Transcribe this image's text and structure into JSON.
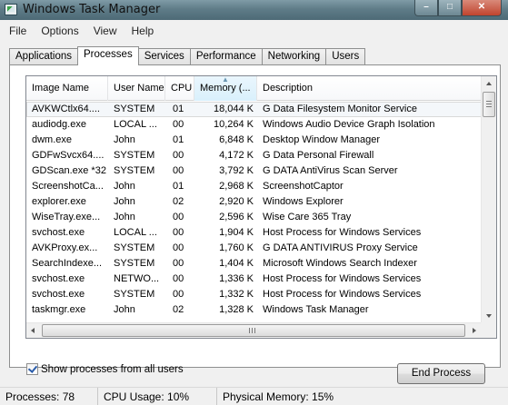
{
  "window": {
    "title": "Windows Task Manager"
  },
  "menu": [
    "File",
    "Options",
    "View",
    "Help"
  ],
  "tabs": [
    "Applications",
    "Processes",
    "Services",
    "Performance",
    "Networking",
    "Users"
  ],
  "active_tab": "Processes",
  "columns": [
    "Image Name",
    "User Name",
    "CPU",
    "Memory (...",
    "Description"
  ],
  "sorted_column": "Memory (...",
  "processes": [
    {
      "name": "AVKWCtlx64....",
      "user": "SYSTEM",
      "cpu": "01",
      "memory": "18,044 K",
      "description": "G Data Filesystem Monitor Service"
    },
    {
      "name": "audiodg.exe",
      "user": "LOCAL ...",
      "cpu": "00",
      "memory": "10,264 K",
      "description": "Windows Audio Device Graph Isolation"
    },
    {
      "name": "dwm.exe",
      "user": "John",
      "cpu": "01",
      "memory": "6,848 K",
      "description": "Desktop Window Manager"
    },
    {
      "name": "GDFwSvcx64....",
      "user": "SYSTEM",
      "cpu": "00",
      "memory": "4,172 K",
      "description": "G Data Personal Firewall"
    },
    {
      "name": "GDScan.exe *32",
      "user": "SYSTEM",
      "cpu": "00",
      "memory": "3,792 K",
      "description": "G DATA AntiVirus Scan Server"
    },
    {
      "name": "ScreenshotCa...",
      "user": "John",
      "cpu": "01",
      "memory": "2,968 K",
      "description": "ScreenshotCaptor"
    },
    {
      "name": "explorer.exe",
      "user": "John",
      "cpu": "02",
      "memory": "2,920 K",
      "description": "Windows Explorer"
    },
    {
      "name": "WiseTray.exe...",
      "user": "John",
      "cpu": "00",
      "memory": "2,596 K",
      "description": "Wise Care 365 Tray"
    },
    {
      "name": "svchost.exe",
      "user": "LOCAL ...",
      "cpu": "00",
      "memory": "1,904 K",
      "description": "Host Process for Windows Services"
    },
    {
      "name": "AVKProxy.ex...",
      "user": "SYSTEM",
      "cpu": "00",
      "memory": "1,760 K",
      "description": "G DATA ANTIVIRUS Proxy Service"
    },
    {
      "name": "SearchIndexe...",
      "user": "SYSTEM",
      "cpu": "00",
      "memory": "1,404 K",
      "description": "Microsoft Windows Search Indexer"
    },
    {
      "name": "svchost.exe",
      "user": "NETWO...",
      "cpu": "00",
      "memory": "1,336 K",
      "description": "Host Process for Windows Services"
    },
    {
      "name": "svchost.exe",
      "user": "SYSTEM",
      "cpu": "00",
      "memory": "1,332 K",
      "description": "Host Process for Windows Services"
    },
    {
      "name": "taskmgr.exe",
      "user": "John",
      "cpu": "02",
      "memory": "1,328 K",
      "description": "Windows Task Manager"
    }
  ],
  "show_all": {
    "label": "Show processes from all users",
    "checked": true
  },
  "end_process_label": "End Process",
  "status": {
    "processes": "Processes: 78",
    "cpu": "CPU Usage: 10%",
    "memory": "Physical Memory: 15%"
  },
  "colors": {
    "titlebar": "#5f7c88",
    "close_button": "#c0442e",
    "sorted_header": "#d9f0fc"
  },
  "icons": [
    "app-icon",
    "minimize-icon",
    "maximize-icon",
    "close-icon",
    "sort-arrow-icon",
    "scroll-up-icon",
    "scroll-down-icon",
    "scroll-left-icon",
    "scroll-right-icon",
    "checkbox-check-icon"
  ]
}
